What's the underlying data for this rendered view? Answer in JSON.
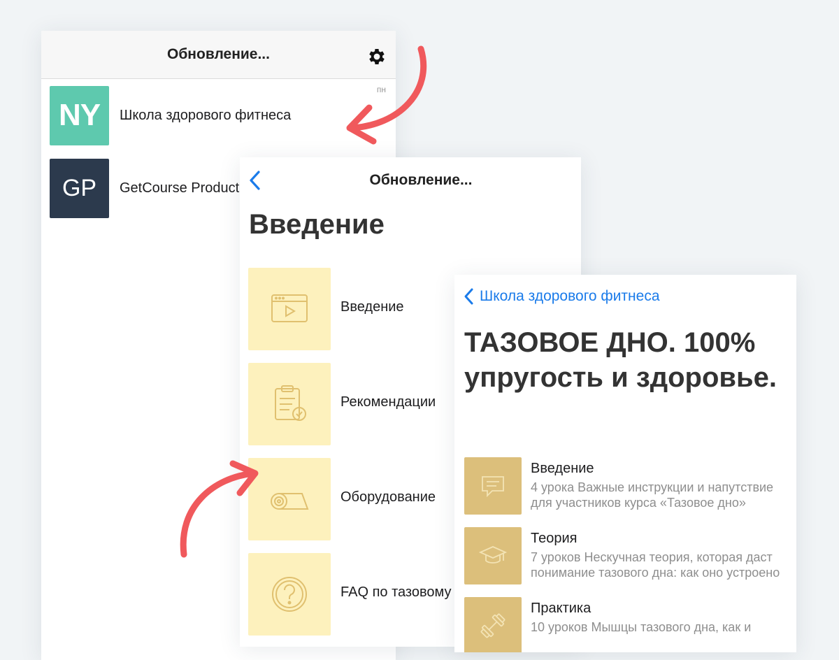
{
  "screen1": {
    "nav_title": "Обновление...",
    "chats": [
      {
        "avatar_text": "NY",
        "name": "Школа здорового фитнеса",
        "day": "пн"
      },
      {
        "avatar_text": "GP",
        "name": "GetCourse Production"
      }
    ]
  },
  "screen2": {
    "nav_title": "Обновление...",
    "page_title": "Введение",
    "lessons": [
      {
        "label": "Введение",
        "icon": "video-player-icon"
      },
      {
        "label": "Рекомендации",
        "icon": "clipboard-check-icon"
      },
      {
        "label": "Оборудование",
        "icon": "yoga-mat-icon"
      },
      {
        "label": "FAQ по тазовому дну",
        "icon": "question-circle-icon"
      }
    ]
  },
  "screen3": {
    "back_label": "Школа здорового фитнеса",
    "course_title": "ТАЗОВОЕ ДНО. 100% упругость и здоровье.",
    "modules": [
      {
        "title": "Введение",
        "desc": "4 урока Важные инструкции и напутствие для участников курса «Тазовое дно»",
        "icon": "chat-bubble-icon"
      },
      {
        "title": "Теория",
        "desc": "7 уроков Нескучная теория, которая даст понимание тазового дна: как оно устроено",
        "icon": "graduation-cap-icon"
      },
      {
        "title": "Практика",
        "desc": "10 уроков Мышцы тазового дна, как и",
        "icon": "dumbbell-icon"
      }
    ]
  },
  "colors": {
    "accent_blue": "#1a7bea",
    "annotation_arrow": "#f0595c",
    "lesson_tile": "#fdf1bd",
    "module_tile": "#dcbf7b",
    "avatar_ny": "#5ec9ae",
    "avatar_gp": "#2c3a4d"
  }
}
